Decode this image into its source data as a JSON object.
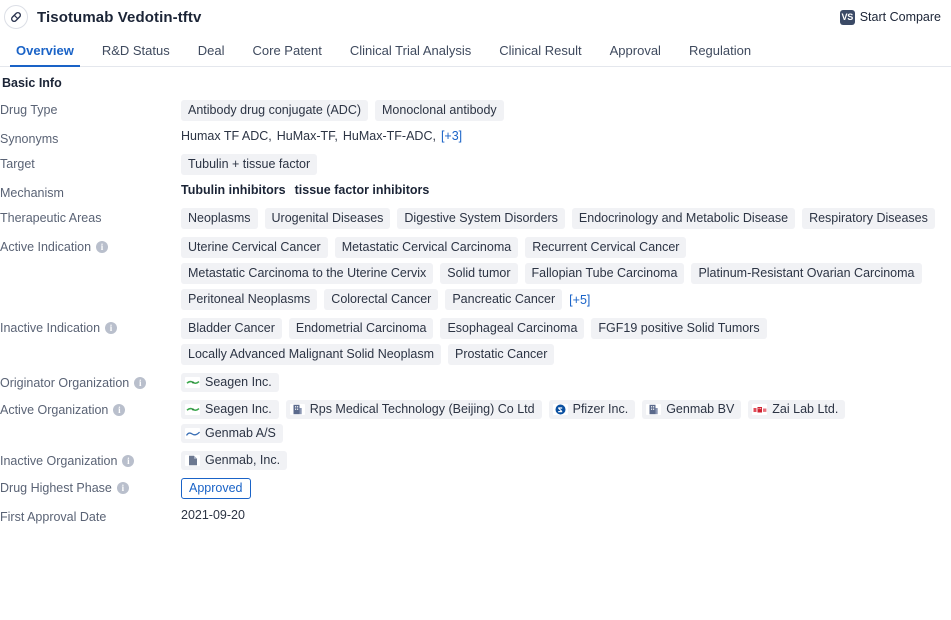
{
  "header": {
    "drug_icon": "pill-capsule-icon",
    "title": "Tisotumab Vedotin-tftv",
    "compare": {
      "badge": "VS",
      "label": "Start Compare"
    }
  },
  "tabs": [
    {
      "label": "Overview",
      "active": true
    },
    {
      "label": "R&D Status",
      "active": false
    },
    {
      "label": "Deal",
      "active": false
    },
    {
      "label": "Core Patent",
      "active": false
    },
    {
      "label": "Clinical Trial Analysis",
      "active": false
    },
    {
      "label": "Clinical Result",
      "active": false
    },
    {
      "label": "Approval",
      "active": false
    },
    {
      "label": "Regulation",
      "active": false
    }
  ],
  "section": {
    "title": "Basic Info"
  },
  "rows": {
    "drug_type": {
      "label": "Drug Type",
      "chips": [
        "Antibody drug conjugate (ADC)",
        "Monoclonal antibody"
      ]
    },
    "synonyms": {
      "label": "Synonyms",
      "items": [
        "Humax TF ADC,",
        "HuMax-TF,",
        "HuMax-TF-ADC,"
      ],
      "more": "[+3]"
    },
    "target": {
      "label": "Target",
      "chips": [
        "Tubulin + tissue factor"
      ]
    },
    "mechanism": {
      "label": "Mechanism",
      "items": [
        "Tubulin inhibitors",
        "tissue factor inhibitors"
      ]
    },
    "therapeutic_areas": {
      "label": "Therapeutic Areas",
      "chips": [
        "Neoplasms",
        "Urogenital Diseases",
        "Digestive System Disorders",
        "Endocrinology and Metabolic Disease",
        "Respiratory Diseases"
      ]
    },
    "active_indication": {
      "label": "Active Indication",
      "info": true,
      "chips": [
        "Uterine Cervical Cancer",
        "Metastatic Cervical Carcinoma",
        "Recurrent Cervical Cancer",
        "Metastatic Carcinoma to the Uterine Cervix",
        "Solid tumor",
        "Fallopian Tube Carcinoma",
        "Platinum-Resistant Ovarian Carcinoma",
        "Peritoneal Neoplasms",
        "Colorectal Cancer",
        "Pancreatic Cancer"
      ],
      "more": "[+5]"
    },
    "inactive_indication": {
      "label": "Inactive Indication",
      "info": true,
      "chips": [
        "Bladder Cancer",
        "Endometrial Carcinoma",
        "Esophageal Carcinoma",
        "FGF19 positive Solid Tumors",
        "Locally Advanced Malignant Solid Neoplasm",
        "Prostatic Cancer"
      ]
    },
    "originator_organization": {
      "label": "Originator Organization",
      "info": true,
      "orgs": [
        {
          "name": "Seagen Inc.",
          "logo": "seagen-logo-icon"
        }
      ]
    },
    "active_organization": {
      "label": "Active Organization",
      "info": true,
      "orgs": [
        {
          "name": "Seagen Inc.",
          "logo": "seagen-logo-icon"
        },
        {
          "name": "Rps Medical Technology (Beijing) Co Ltd",
          "logo": "building-logo-icon"
        },
        {
          "name": "Pfizer Inc.",
          "logo": "pfizer-logo-icon"
        },
        {
          "name": "Genmab BV",
          "logo": "building-logo-icon"
        },
        {
          "name": "Zai Lab Ltd.",
          "logo": "zailab-logo-icon"
        },
        {
          "name": "Genmab A/S",
          "logo": "genmab-wave-logo-icon"
        }
      ]
    },
    "inactive_organization": {
      "label": "Inactive Organization",
      "info": true,
      "orgs": [
        {
          "name": "Genmab, Inc.",
          "logo": "document-logo-icon"
        }
      ]
    },
    "drug_highest_phase": {
      "label": "Drug Highest Phase",
      "info": true,
      "badge": "Approved"
    },
    "first_approval_date": {
      "label": "First Approval Date",
      "value": "2021-09-20"
    }
  },
  "colors": {
    "accent_blue": "#1a63c7",
    "chip_bg": "#f1f2f5",
    "label_gray": "#5a6375",
    "text_dark": "#1b2436"
  }
}
